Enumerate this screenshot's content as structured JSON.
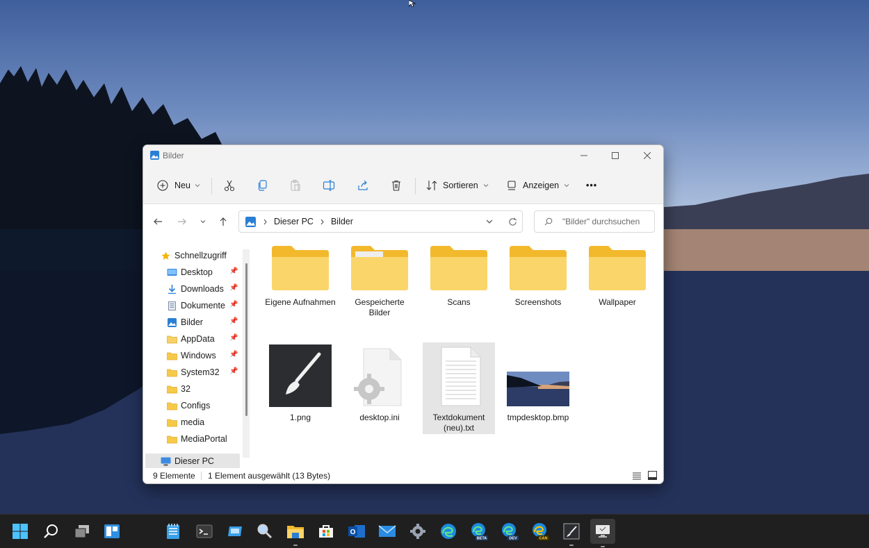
{
  "window": {
    "title": "Bilder",
    "toolbar": {
      "new_label": "Neu",
      "sort_label": "Sortieren",
      "view_label": "Anzeigen",
      "more_label": "•••"
    },
    "address": {
      "crumbs": [
        "Dieser PC",
        "Bilder"
      ],
      "search_placeholder": "\"Bilder\" durchsuchen"
    },
    "nav_pane": {
      "quick_access": "Schnellzugriff",
      "items": [
        {
          "label": "Desktop",
          "icon": "desktop-icon",
          "pinned": true
        },
        {
          "label": "Downloads",
          "icon": "download-icon",
          "pinned": true
        },
        {
          "label": "Dokumente",
          "icon": "document-icon",
          "pinned": true
        },
        {
          "label": "Bilder",
          "icon": "pictures-icon",
          "pinned": true
        },
        {
          "label": "AppData",
          "icon": "folder-icon",
          "pinned": true
        },
        {
          "label": "Windows",
          "icon": "folder-icon",
          "pinned": true
        },
        {
          "label": "System32",
          "icon": "folder-icon",
          "pinned": true
        },
        {
          "label": "32",
          "icon": "folder-icon",
          "pinned": false
        },
        {
          "label": "Configs",
          "icon": "folder-icon",
          "pinned": false
        },
        {
          "label": "media",
          "icon": "folder-icon",
          "pinned": false
        },
        {
          "label": "MediaPortal",
          "icon": "folder-icon",
          "pinned": false
        }
      ],
      "this_pc": "Dieser PC"
    },
    "files": [
      {
        "label": "Eigene Aufnahmen",
        "type": "folder"
      },
      {
        "label": "Gespeicherte Bilder",
        "type": "folder"
      },
      {
        "label": "Scans",
        "type": "folder"
      },
      {
        "label": "Screenshots",
        "type": "folder"
      },
      {
        "label": "Wallpaper",
        "type": "folder"
      },
      {
        "label": "1.png",
        "type": "image"
      },
      {
        "label": "desktop.ini",
        "type": "settings-file"
      },
      {
        "label": "Textdokument (neu).txt",
        "type": "text-file",
        "selected": true
      },
      {
        "label": "tmpdesktop.bmp",
        "type": "bitmap"
      }
    ],
    "status": {
      "count": "9 Elemente",
      "selection": "1 Element ausgewählt (13 Bytes)"
    }
  },
  "taskbar": {
    "icons": [
      "start-icon",
      "search-icon",
      "task-view-icon",
      "widgets-icon",
      "notepad-icon",
      "terminal-icon",
      "remote-desktop-icon",
      "magnifier-icon",
      "file-explorer-icon",
      "store-icon",
      "outlook-icon",
      "mail-icon",
      "settings-icon",
      "edge-icon",
      "edge-beta-icon",
      "edge-dev-icon",
      "edge-canary-icon",
      "paint-icon",
      "computer-icon"
    ],
    "edge_badges": [
      "BETA",
      "DEV",
      "CAN"
    ]
  },
  "colors": {
    "folder": "#f7c948",
    "accent": "#0067c0",
    "selection": "#e5e5e5"
  }
}
